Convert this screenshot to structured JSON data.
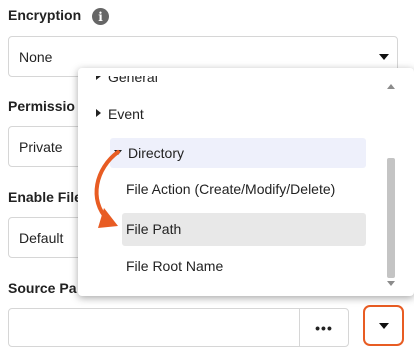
{
  "encryption": {
    "label": "Encryption",
    "info_icon": "i",
    "value": "None"
  },
  "permissions": {
    "label": "Permissio",
    "value": "Private"
  },
  "enable_files": {
    "label": "Enable File",
    "value": "Default"
  },
  "source_path": {
    "label": "Source Pa",
    "value": "",
    "browse_label": "•••"
  },
  "tree": {
    "items": [
      {
        "label": "General",
        "expander": "triangle-right"
      },
      {
        "label": "Event",
        "expander": "triangle-right"
      },
      {
        "label": "Directory",
        "expander": "triangle-down"
      },
      {
        "label": "File Action (Create/Modify/Delete)"
      },
      {
        "label": "File Path"
      },
      {
        "label": "File Root Name"
      }
    ]
  },
  "colors": {
    "annotation": "#e85c23",
    "directory_highlight": "#eef0fb",
    "file_path_highlight": "#e8e8e8"
  }
}
